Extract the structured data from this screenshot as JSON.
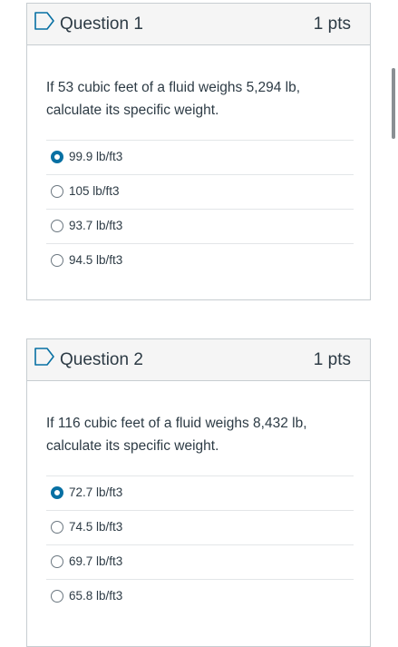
{
  "questions": [
    {
      "title": "Question 1",
      "points": "1 pts",
      "text": "If 53 cubic feet of a fluid weighs 5,294 lb, calculate its specific weight.",
      "answers": [
        {
          "label": "99.9 lb/ft3",
          "selected": true
        },
        {
          "label": "105 lb/ft3",
          "selected": false
        },
        {
          "label": "93.7 lb/ft3",
          "selected": false
        },
        {
          "label": "94.5 lb/ft3",
          "selected": false
        }
      ]
    },
    {
      "title": "Question 2",
      "points": "1 pts",
      "text": "If 116 cubic feet of a fluid weighs 8,432 lb, calculate its specific weight.",
      "answers": [
        {
          "label": "72.7 lb/ft3",
          "selected": true
        },
        {
          "label": "74.5 lb/ft3",
          "selected": false
        },
        {
          "label": "69.7 lb/ft3",
          "selected": false
        },
        {
          "label": "65.8 lb/ft3",
          "selected": false
        }
      ]
    }
  ],
  "colors": {
    "accent": "#0770a3",
    "header_bg": "#f5f5f5",
    "border": "#c7cdd1"
  },
  "icons": {
    "flag": "bookmark-flag-icon"
  }
}
